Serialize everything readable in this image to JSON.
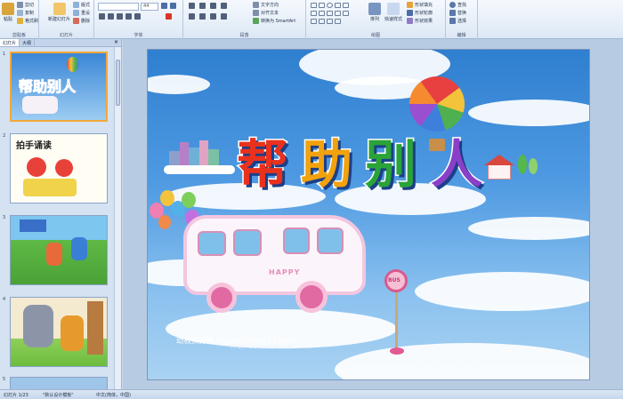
{
  "ribbon": {
    "clipboard": {
      "label": "剪贴板",
      "paste": "粘贴",
      "cut": "剪切",
      "copy": "复制",
      "format_painter": "格式刷"
    },
    "slides": {
      "label": "幻灯片",
      "new_slide": "新建幻灯片",
      "layout": "版式",
      "reset": "重设",
      "delete": "删除"
    },
    "font": {
      "label": "字体",
      "font_name": "",
      "font_size": "44"
    },
    "paragraph": {
      "label": "段落",
      "text_direction": "文字方向",
      "align_text": "对齐文本",
      "convert_smartart": "转换为 SmartArt"
    },
    "drawing": {
      "label": "绘图",
      "arrange": "排列",
      "quick_styles": "快速样式",
      "shape_fill": "形状填充",
      "shape_outline": "形状轮廓",
      "shape_effects": "形状效果"
    },
    "editing": {
      "label": "编辑",
      "find": "查找",
      "replace": "替换",
      "select": "选择"
    }
  },
  "panel": {
    "tab_slides": "幻灯片",
    "tab_outline": "大纲",
    "thumbnails": [
      {
        "number": "1",
        "caption": "帮助别人"
      },
      {
        "number": "2",
        "caption": "拍手诵读"
      },
      {
        "number": "3",
        "caption": ""
      },
      {
        "number": "4",
        "caption": ""
      },
      {
        "number": "5",
        "caption": ""
      }
    ]
  },
  "slide": {
    "title_chars": [
      "帮",
      "助",
      "别",
      "人"
    ],
    "bus_text": "HAPPY",
    "sign_text": "BUS",
    "watermark": "幼教资源网 ziyuan.baby611.com",
    "watermark_sub": "PPT课件 FLASH课件 教学视频 试卷"
  },
  "status": {
    "slide_info": "幻灯片 1/23",
    "theme": "\"默认设计模板\"",
    "language": "中文(简体，中国)"
  },
  "colors": {
    "title": [
      "#e8321e",
      "#f2a20c",
      "#2aa339",
      "#8a3fc9"
    ],
    "selection": "#f2a83a",
    "ribbon_bg": "#dde8f5"
  }
}
